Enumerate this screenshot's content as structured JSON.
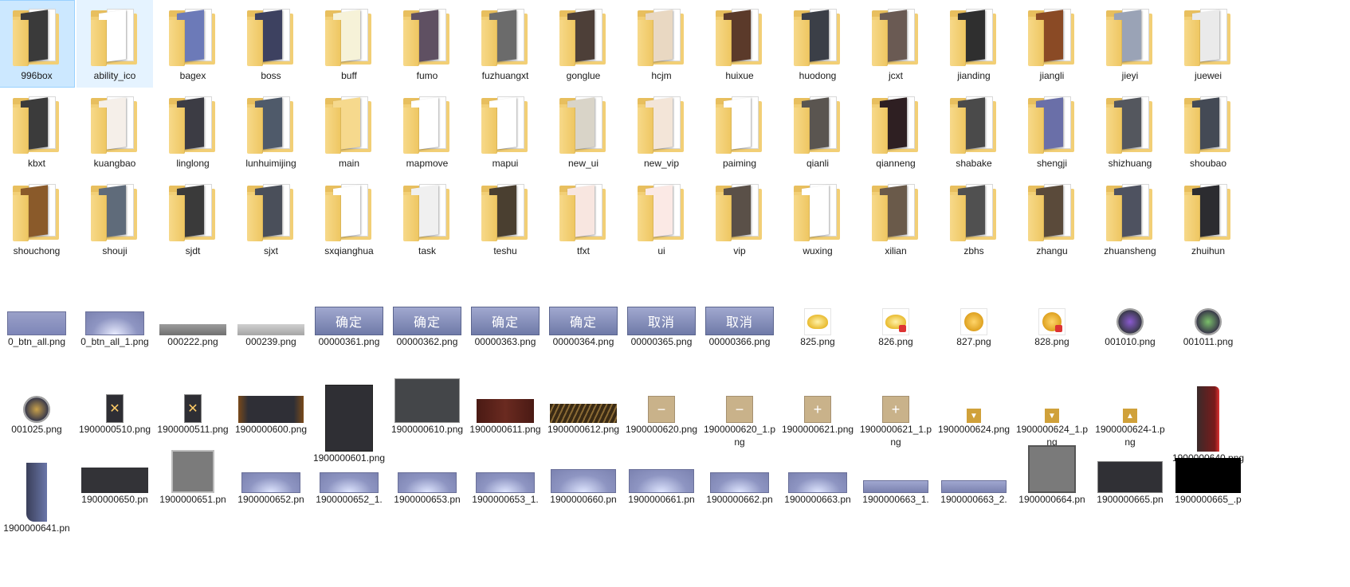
{
  "folders": [
    {
      "label": "996box",
      "thumb": "#3a3a3a",
      "selected": true
    },
    {
      "label": "ability_ico",
      "thumb": "#ffffff",
      "hover": true
    },
    {
      "label": "bagex",
      "thumb": "#6c7ab8"
    },
    {
      "label": "boss",
      "thumb": "#3d4160"
    },
    {
      "label": "buff",
      "thumb": "#f6f2d8"
    },
    {
      "label": "fumo",
      "thumb": "#5f5062"
    },
    {
      "label": "fuzhuangxt",
      "thumb": "#6b6b6b"
    },
    {
      "label": "gonglue",
      "thumb": "#4d3f38"
    },
    {
      "label": "hcjm",
      "thumb": "#e9d8c2"
    },
    {
      "label": "huixue",
      "thumb": "#5b3a2a"
    },
    {
      "label": "huodong",
      "thumb": "#3b3f47"
    },
    {
      "label": "jcxt",
      "thumb": "#6a5a53"
    },
    {
      "label": "jianding",
      "thumb": "#2f2f2f"
    },
    {
      "label": "jiangli",
      "thumb": "#8a4a25"
    },
    {
      "label": "jieyi",
      "thumb": "#9aa3b6"
    },
    {
      "label": "juewei",
      "thumb": "#eaeaea"
    },
    {
      "label": "kbxt",
      "thumb": "#3b3b3b"
    },
    {
      "label": "kuangbao",
      "thumb": "#f5efe9"
    },
    {
      "label": "linglong",
      "thumb": "#3c3c44"
    },
    {
      "label": "lunhuimijing",
      "thumb": "#4f5a6a"
    },
    {
      "label": "main",
      "thumb": "#f6d98d"
    },
    {
      "label": "mapmove",
      "thumb": "#ffffff"
    },
    {
      "label": "mapui",
      "thumb": "#ffffff"
    },
    {
      "label": "new_ui",
      "thumb": "#d9d4c8"
    },
    {
      "label": "new_vip",
      "thumb": "#f3e5d8"
    },
    {
      "label": "paiming",
      "thumb": "#ffffff"
    },
    {
      "label": "qianli",
      "thumb": "#5a5550"
    },
    {
      "label": "qianneng",
      "thumb": "#2e1f22"
    },
    {
      "label": "shabake",
      "thumb": "#4a4a4a"
    },
    {
      "label": "shengji",
      "thumb": "#6a6fa8"
    },
    {
      "label": "shizhuang",
      "thumb": "#54575e"
    },
    {
      "label": "shoubao",
      "thumb": "#444a55"
    },
    {
      "label": "shouchong",
      "thumb": "#8a5a2a"
    },
    {
      "label": "shouji",
      "thumb": "#5f6b7a"
    },
    {
      "label": "sjdt",
      "thumb": "#3a3a3a"
    },
    {
      "label": "sjxt",
      "thumb": "#4a4f5a"
    },
    {
      "label": "sxqianghua",
      "thumb": "#ffffff"
    },
    {
      "label": "task",
      "thumb": "#f0f0f0"
    },
    {
      "label": "teshu",
      "thumb": "#4a3f30"
    },
    {
      "label": "tfxt",
      "thumb": "#f8e6e0"
    },
    {
      "label": "ui",
      "thumb": "#fbe9e5"
    },
    {
      "label": "vip",
      "thumb": "#5a5048"
    },
    {
      "label": "wuxing",
      "thumb": "#ffffff"
    },
    {
      "label": "xilian",
      "thumb": "#6a5a4a"
    },
    {
      "label": "zbhs",
      "thumb": "#505050"
    },
    {
      "label": "zhangu",
      "thumb": "#5a4a3a"
    },
    {
      "label": "zhuansheng",
      "thumb": "#4e5260"
    },
    {
      "label": "zhuihun",
      "thumb": "#2c2c30"
    }
  ],
  "files_row1": [
    {
      "label": "0_btn_all.png",
      "kind": "plainbtn"
    },
    {
      "label": "0_btn_all_1.png",
      "kind": "plainbtn2"
    },
    {
      "label": "000222.png",
      "kind": "bar1"
    },
    {
      "label": "000239.png",
      "kind": "bar2"
    },
    {
      "label": "00000361.png",
      "kind": "textbtn",
      "text": "确定"
    },
    {
      "label": "00000362.png",
      "kind": "textbtn",
      "text": "确定"
    },
    {
      "label": "00000363.png",
      "kind": "textbtn",
      "text": "确定"
    },
    {
      "label": "00000364.png",
      "kind": "textbtn",
      "text": "确定"
    },
    {
      "label": "00000365.png",
      "kind": "textbtn",
      "text": "取消"
    },
    {
      "label": "00000366.png",
      "kind": "textbtn",
      "text": "取消"
    },
    {
      "label": "825.png",
      "kind": "gold"
    },
    {
      "label": "826.png",
      "kind": "goldlock"
    },
    {
      "label": "827.png",
      "kind": "coin"
    },
    {
      "label": "828.png",
      "kind": "coinlock"
    },
    {
      "label": "001010.png",
      "kind": "gem1"
    },
    {
      "label": "001011.png",
      "kind": "gem2"
    }
  ],
  "files_row2": [
    {
      "label": "001025.png",
      "kind": "gem3"
    },
    {
      "label": "1900000510.png",
      "kind": "xdark"
    },
    {
      "label": "1900000511.png",
      "kind": "xdark"
    },
    {
      "label": "1900000600.png",
      "kind": "darkbar"
    },
    {
      "label": "1900000601.png",
      "kind": "darkpanel"
    },
    {
      "label": "1900000610.png",
      "kind": "darkwide"
    },
    {
      "label": "1900000611.png",
      "kind": "redbar"
    },
    {
      "label": "1900000612.png",
      "kind": "goldbar"
    },
    {
      "label": "1900000620.png",
      "kind": "minus"
    },
    {
      "label": "1900000620_1.png",
      "kind": "minus"
    },
    {
      "label": "1900000621.png",
      "kind": "plus"
    },
    {
      "label": "1900000621_1.png",
      "kind": "plus"
    },
    {
      "label": "1900000624.png",
      "kind": "down"
    },
    {
      "label": "1900000624_1.png",
      "kind": "down"
    },
    {
      "label": "1900000624-1.png",
      "kind": "up"
    },
    {
      "label": "1900000640.png",
      "kind": "redtall"
    }
  ],
  "files_row3": [
    {
      "label": "1900000641.pn",
      "kind": "bluetall"
    },
    {
      "label": "1900000650.pn",
      "kind": "darkflat"
    },
    {
      "label": "1900000651.pn",
      "kind": "greysq"
    },
    {
      "label": "1900000652.pn",
      "kind": "bluebar"
    },
    {
      "label": "1900000652_1.",
      "kind": "bluebar"
    },
    {
      "label": "1900000653.pn",
      "kind": "bluebar"
    },
    {
      "label": "1900000653_1.",
      "kind": "bluebar"
    },
    {
      "label": "1900000660.pn",
      "kind": "bluebar2"
    },
    {
      "label": "1900000661.pn",
      "kind": "bluebar2"
    },
    {
      "label": "1900000662.pn",
      "kind": "bluebar"
    },
    {
      "label": "1900000663.pn",
      "kind": "bluebar"
    },
    {
      "label": "1900000663_1.",
      "kind": "bluethin"
    },
    {
      "label": "1900000663_2.",
      "kind": "bluethin"
    },
    {
      "label": "1900000664.pn",
      "kind": "greybig"
    },
    {
      "label": "1900000665.pn",
      "kind": "darkbig"
    },
    {
      "label": "1900000665_.p",
      "kind": "black"
    }
  ]
}
